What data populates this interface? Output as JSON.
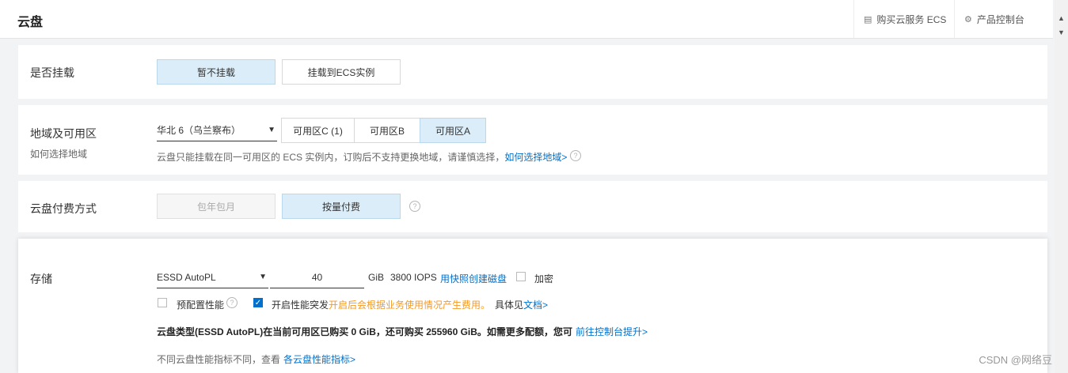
{
  "header": {
    "title": "云盘",
    "buy_ecs": "购买云服务 ECS",
    "console": "产品控制台"
  },
  "mount": {
    "label": "是否挂载",
    "options": [
      "暂不挂载",
      "挂载到ECS实例"
    ],
    "selected": "暂不挂载"
  },
  "region": {
    "label": "地域及可用区",
    "sublabel": "如何选择地域",
    "region_value": "华北 6（乌兰察布）",
    "zones": [
      "可用区C (1)",
      "可用区B",
      "可用区A"
    ],
    "selected_zone": "可用区A",
    "note": "云盘只能挂载在同一可用区的 ECS 实例内，订购后不支持更换地域，请谨慎选择，",
    "note_link": "如何选择地域>"
  },
  "billing": {
    "label": "云盘付费方式",
    "options": [
      "包年包月",
      "按量付费"
    ],
    "selected": "按量付费"
  },
  "storage": {
    "label": "存储",
    "disk_type": "ESSD AutoPL",
    "size": "40",
    "unit": "GiB",
    "iops": "3800 IOPS",
    "snapshot_link": "用快照创建磁盘",
    "encrypt_label": "加密",
    "provisioned_label": "预配置性能",
    "burst_label": "开启性能突发",
    "burst_warning": "开启后会根据业务使用情况产生费用。",
    "burst_detail": "具体见",
    "burst_doc_link": "文档>",
    "quota_text": "云盘类型(ESSD AutoPL)在当前可用区已购买 0 GiB，还可购买 255960 GiB。如需更多配额，您可",
    "quota_link": "前往控制台提升>",
    "perf_text": "不同云盘性能指标不同，查看",
    "perf_link": "各云盘性能指标>"
  },
  "watermark": "CSDN @网络豆"
}
